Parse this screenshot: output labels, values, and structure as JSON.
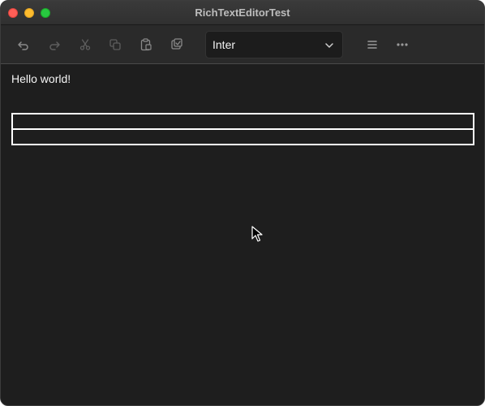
{
  "window": {
    "title": "RichTextEditorTest"
  },
  "toolbar": {
    "buttons": [
      {
        "name": "undo-button",
        "icon": "undo-icon"
      },
      {
        "name": "redo-button",
        "icon": "redo-icon"
      },
      {
        "name": "cut-button",
        "icon": "scissors-icon"
      },
      {
        "name": "copy-button",
        "icon": "copy-icon"
      },
      {
        "name": "paste-button",
        "icon": "paste-icon"
      },
      {
        "name": "paste-style-button",
        "icon": "clipboard-check-icon"
      },
      {
        "name": "align-button",
        "icon": "menu-lines-icon"
      },
      {
        "name": "more-button",
        "icon": "ellipsis-icon"
      }
    ],
    "font": {
      "selected": "Inter"
    }
  },
  "editor": {
    "text": "Hello world!",
    "table": {
      "rows": [
        [
          ""
        ],
        [
          ""
        ]
      ]
    }
  },
  "colors": {
    "background": "#1e1e1e",
    "toolbar": "#2a2a2a",
    "titlebar": "#333333",
    "text": "#f5f5f5",
    "icon_muted": "#8a8a8a",
    "table_border": "#ffffff"
  }
}
